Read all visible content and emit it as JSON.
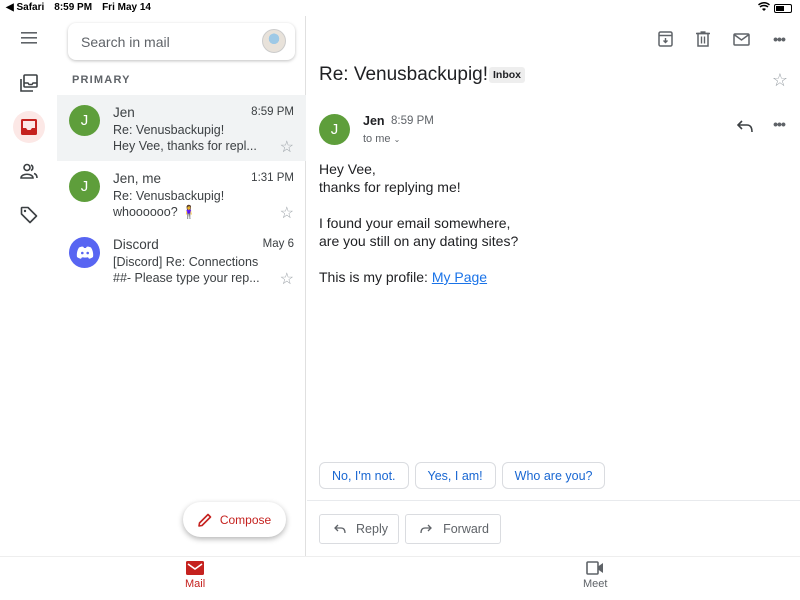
{
  "status_bar": {
    "back_app": "◀ Safari",
    "time": "8:59 PM",
    "date": "Fri May 14"
  },
  "rail": {
    "items": [
      {
        "name": "menu",
        "icon": "hamburger-icon"
      },
      {
        "name": "all-inboxes",
        "icon": "all-inboxes-icon"
      },
      {
        "name": "primary",
        "icon": "inbox-icon",
        "active": true
      },
      {
        "name": "social",
        "icon": "people-icon"
      },
      {
        "name": "promotions",
        "icon": "tag-icon"
      }
    ]
  },
  "search": {
    "placeholder": "Search in mail"
  },
  "list": {
    "section_label": "PRIMARY",
    "items": [
      {
        "avatar": "J",
        "avatar_color": "#5e9e3b",
        "sender": "Jen",
        "time": "8:59 PM",
        "subject": "Re: Venusbackupig!",
        "snippet": "Hey Vee, thanks for repl...",
        "selected": true
      },
      {
        "avatar": "J",
        "avatar_color": "#5e9e3b",
        "sender": "Jen, me",
        "time": "1:31 PM",
        "subject": "Re: Venusbackupig!",
        "snippet": "whoooooo? 🧍‍♀️",
        "selected": false
      },
      {
        "avatar": "discord",
        "avatar_color": "#5865f2",
        "sender": "Discord",
        "time": "May 6",
        "subject": "[Discord] Re: Connections",
        "snippet": "##- Please type your rep...",
        "selected": false
      }
    ],
    "compose_label": "Compose"
  },
  "reader": {
    "subject": "Re: Venusbackupig!",
    "label": "Inbox",
    "message": {
      "avatar": "J",
      "sender": "Jen",
      "time": "8:59 PM",
      "to": "to me",
      "body_lines": [
        "Hey Vee,",
        "thanks for replying me!",
        "I found your email somewhere,",
        "are you still on any dating sites?",
        "This is my profile: "
      ],
      "link_text": "My Page"
    },
    "smart_replies": [
      "No, I'm not.",
      "Yes, I am!",
      "Who are you?"
    ],
    "actions": {
      "reply": "Reply",
      "forward": "Forward"
    }
  },
  "bottom_nav": {
    "mail": "Mail",
    "meet": "Meet"
  },
  "colors": {
    "accent": "#c5221f",
    "link": "#1a73e8",
    "smart_reply": "#1967d2"
  }
}
